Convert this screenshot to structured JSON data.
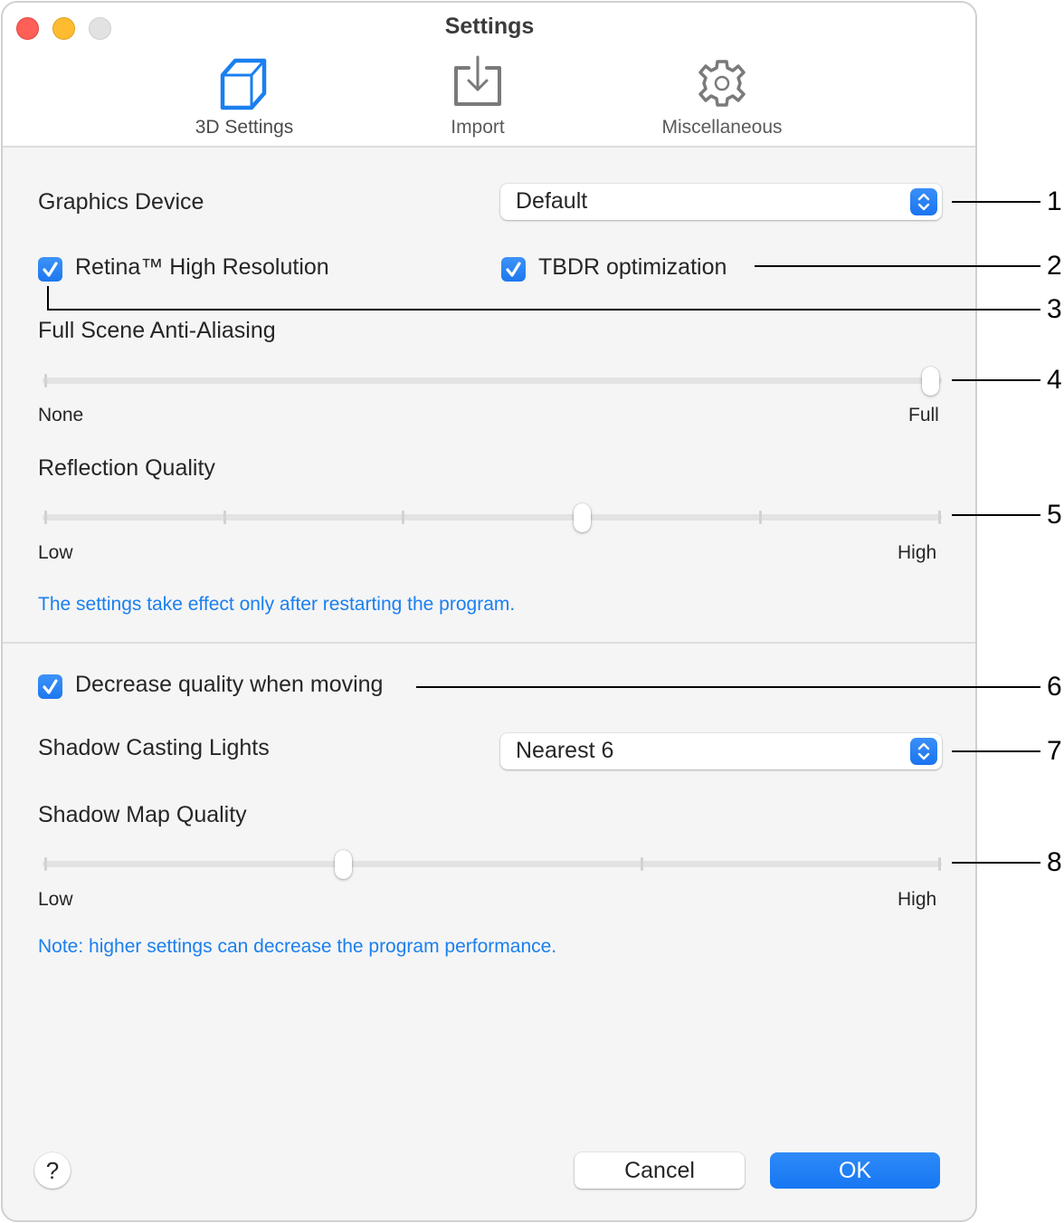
{
  "window": {
    "title": "Settings",
    "traffic_lights": [
      "close",
      "minimize",
      "zoom"
    ]
  },
  "toolbar": {
    "tabs": [
      {
        "label": "3D Settings",
        "icon": "cube-icon",
        "active": true
      },
      {
        "label": "Import",
        "icon": "import-tray-icon",
        "active": false
      },
      {
        "label": "Miscellaneous",
        "icon": "gear-icon",
        "active": false
      }
    ]
  },
  "settings": {
    "graphics_device": {
      "label": "Graphics Device",
      "value": "Default"
    },
    "retina": {
      "label": "Retina™ High Resolution",
      "checked": true
    },
    "tbdr": {
      "label": "TBDR optimization",
      "checked": true
    },
    "anti_aliasing": {
      "label": "Full Scene Anti-Aliasing",
      "min_label": "None",
      "max_label": "Full",
      "steps": 2,
      "value_index": 1
    },
    "reflection_quality": {
      "label": "Reflection Quality",
      "min_label": "Low",
      "max_label": "High",
      "steps": 6,
      "value_index": 3
    },
    "restart_note": "The settings take effect only after restarting the program.",
    "decrease_quality": {
      "label": "Decrease quality when moving",
      "checked": true
    },
    "shadow_lights": {
      "label": "Shadow Casting Lights",
      "value": "Nearest 6"
    },
    "shadow_map_quality": {
      "label": "Shadow Map Quality",
      "min_label": "Low",
      "max_label": "High",
      "steps": 4,
      "value_index": 1
    },
    "performance_note": "Note: higher settings can decrease the program performance."
  },
  "footer": {
    "help_label": "?",
    "cancel_label": "Cancel",
    "ok_label": "OK"
  },
  "callouts": [
    "1",
    "2",
    "3",
    "4",
    "5",
    "6",
    "7",
    "8"
  ],
  "colors": {
    "accent": "#1a7ff0",
    "note_text": "#1a7ff0",
    "close": "#fe5f57",
    "minimize": "#febc2e",
    "zoom": "#e2e2e2"
  }
}
